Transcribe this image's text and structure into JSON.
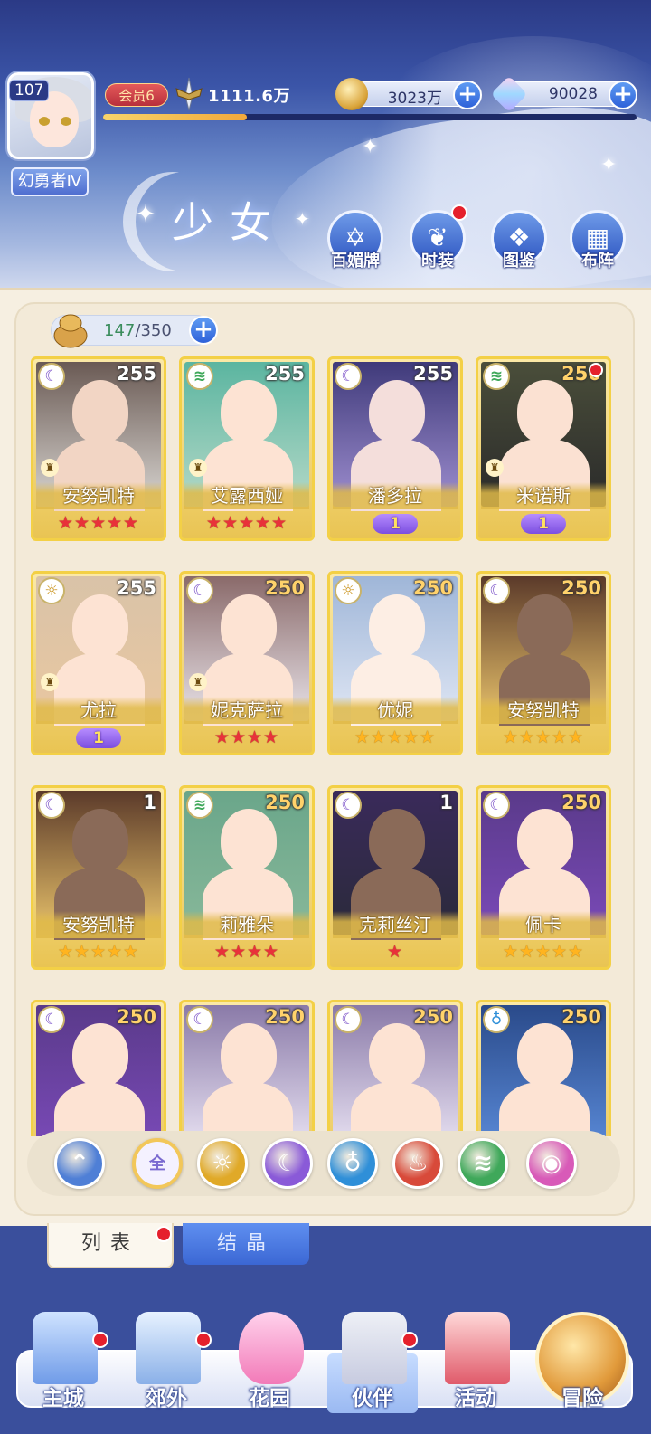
{
  "player": {
    "level": "107",
    "title": "幻勇者Ⅳ",
    "vip": "会员6",
    "power": "1111.6万",
    "exp_fraction": 0.27
  },
  "resources": {
    "gold": "3023万",
    "gems": "90028"
  },
  "page_title": "少女",
  "menu": [
    {
      "label": "百媚牌",
      "icon": "card-deck-icon",
      "dot": false
    },
    {
      "label": "时装",
      "icon": "costume-icon",
      "dot": true
    },
    {
      "label": "图鉴",
      "icon": "book-icon",
      "dot": false
    },
    {
      "label": "布阵",
      "icon": "formation-grid-icon",
      "dot": false
    }
  ],
  "roster": {
    "current": "147",
    "max": "350"
  },
  "cards": [
    {
      "name": "安努凯特",
      "level": "255",
      "element": "moon",
      "stars": 5,
      "star_color": "red",
      "awaken": null,
      "role": true,
      "dot": false
    },
    {
      "name": "艾露西娅",
      "level": "255",
      "element": "wind",
      "stars": 5,
      "star_color": "red",
      "awaken": null,
      "role": true,
      "dot": false
    },
    {
      "name": "潘多拉",
      "level": "255",
      "element": "moon",
      "stars": 0,
      "star_color": "red",
      "awaken": "1",
      "role": false,
      "dot": false
    },
    {
      "name": "米诺斯",
      "level": "250",
      "element": "wind",
      "stars": 0,
      "star_color": "red",
      "awaken": "1",
      "role": true,
      "dot": true
    },
    {
      "name": "尤拉",
      "level": "255",
      "element": "sun",
      "stars": 0,
      "star_color": "red",
      "awaken": "1",
      "role": true,
      "dot": false
    },
    {
      "name": "妮克萨拉",
      "level": "250",
      "element": "moon",
      "stars": 4,
      "star_color": "red",
      "awaken": null,
      "role": true,
      "dot": false
    },
    {
      "name": "优妮",
      "level": "250",
      "element": "sun",
      "stars": 5,
      "star_color": "gold",
      "awaken": null,
      "role": false,
      "dot": false
    },
    {
      "name": "安努凯特",
      "level": "250",
      "element": "moon",
      "stars": 5,
      "star_color": "gold",
      "awaken": null,
      "role": false,
      "dot": false
    },
    {
      "name": "安努凯特",
      "level": "1",
      "element": "moon",
      "stars": 5,
      "star_color": "gold",
      "awaken": null,
      "role": false,
      "dot": false
    },
    {
      "name": "莉雅朵",
      "level": "250",
      "element": "wind",
      "stars": 4,
      "star_color": "red",
      "awaken": null,
      "role": false,
      "dot": false
    },
    {
      "name": "克莉丝汀",
      "level": "1",
      "element": "moon",
      "stars": 1,
      "star_color": "red",
      "awaken": null,
      "role": false,
      "dot": false
    },
    {
      "name": "佩卡",
      "level": "250",
      "element": "moon",
      "stars": 5,
      "star_color": "gold",
      "awaken": null,
      "role": false,
      "dot": false
    },
    {
      "name": "",
      "level": "250",
      "element": "moon",
      "stars": 0,
      "star_color": "gold",
      "awaken": null,
      "role": false,
      "dot": false
    },
    {
      "name": "",
      "level": "250",
      "element": "moon",
      "stars": 0,
      "star_color": "gold",
      "awaken": null,
      "role": false,
      "dot": false
    },
    {
      "name": "",
      "level": "250",
      "element": "moon",
      "stars": 0,
      "star_color": "gold",
      "awaken": null,
      "role": false,
      "dot": false
    },
    {
      "name": "",
      "level": "250",
      "element": "water",
      "stars": 0,
      "star_color": "gold",
      "awaken": null,
      "role": false,
      "dot": false
    }
  ],
  "filters": [
    {
      "key": "sort",
      "label": "",
      "icon": "sort-icon",
      "color": "#4f7fd6"
    },
    {
      "key": "all",
      "label": "全",
      "icon": "all-icon",
      "color": "#f4f1ff"
    },
    {
      "key": "sun",
      "label": "",
      "icon": "sun-element-icon",
      "color": "#e0a928"
    },
    {
      "key": "moon",
      "label": "",
      "icon": "moon-element-icon",
      "color": "#8a5ad8"
    },
    {
      "key": "water",
      "label": "",
      "icon": "water-element-icon",
      "color": "#2f8fd8"
    },
    {
      "key": "fire",
      "label": "",
      "icon": "fire-element-icon",
      "color": "#d84a3a"
    },
    {
      "key": "wind",
      "label": "",
      "icon": "wind-element-icon",
      "color": "#3fa85a"
    },
    {
      "key": "light",
      "label": "",
      "icon": "light-element-icon",
      "color": "#d85ab8"
    }
  ],
  "tabs": {
    "list": "列表",
    "crystal": "结晶"
  },
  "nav": [
    {
      "label": "主城",
      "dot": true,
      "selected": false
    },
    {
      "label": "郊外",
      "dot": true,
      "selected": false
    },
    {
      "label": "花园",
      "dot": false,
      "selected": false
    },
    {
      "label": "伙伴",
      "dot": true,
      "selected": true
    },
    {
      "label": "活动",
      "dot": false,
      "selected": false
    },
    {
      "label": "冒险",
      "dot": false,
      "selected": false
    }
  ]
}
